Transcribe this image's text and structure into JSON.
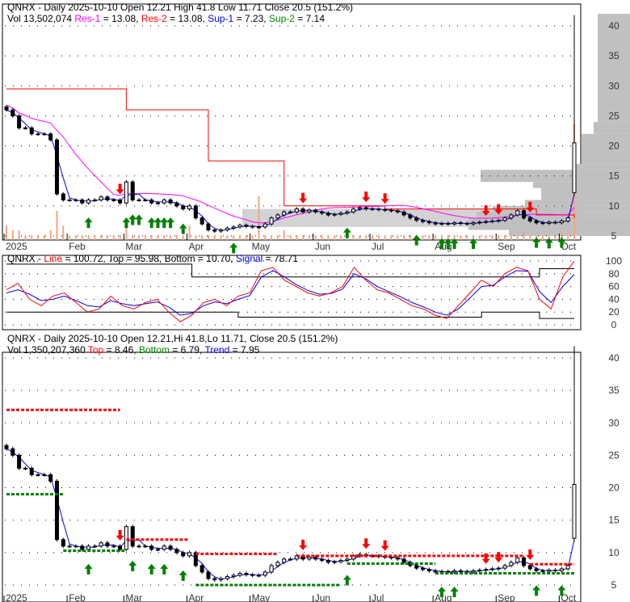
{
  "top_header": {
    "line1": "QNRX - Daily 2025-10-10 Open 12.21  High 41.8  Low 11.71  Close 20.5 (151.2%)",
    "vol": "Vol 13,502,074",
    "res1_label": "Res-1",
    "res1_val": " = 13.08, ",
    "res2_label": "Res-2",
    "res2_val": " = 13.08, ",
    "sup1_label": "Sup-1",
    "sup1_val": " = 7.23, ",
    "sup2_label": "Sup-2",
    "sup2_val": " = 7.14"
  },
  "mid_header": {
    "prefix": "QNRX - ",
    "line_label": "Line",
    "rest": " = 100.72, Top = 95.98, Bottom = 10.70, ",
    "signal_label": "Signal",
    "signal_val": " = 78.71"
  },
  "bot_header": {
    "line1": "QNRX - Daily 2025-10-10 Open 12.21,Hi 41.8,Lo 11.71, Close 20.5 (151.2%)",
    "vol": "Vol 1,350,207,360 ",
    "top_label": "Top",
    "top_val": " = 8.46, ",
    "bottom_label": "Bottom",
    "bottom_val": " = 6.79, ",
    "trend_label": "Trend",
    "trend_val": " = 7.95"
  },
  "colors": {
    "up": "#008000",
    "down": "#ff0000",
    "res1": "#ff00ff",
    "res2": "#ff0000",
    "sup1": "#0000ff",
    "sup2": "#008000",
    "volume": "#f4a582",
    "profile": "#c0c0c0"
  },
  "chart_data": {
    "type": "candlestick",
    "x_ticks": [
      {
        "label": "2025",
        "i": 0
      },
      {
        "label": "Feb",
        "i": 10
      },
      {
        "label": "Mar",
        "i": 19
      },
      {
        "label": "Apr",
        "i": 29
      },
      {
        "label": "May",
        "i": 39
      },
      {
        "label": "Jun",
        "i": 49
      },
      {
        "label": "Jul",
        "i": 58
      },
      {
        "label": "Aug",
        "i": 68
      },
      {
        "label": "Sep",
        "i": 78
      },
      {
        "label": "Oct",
        "i": 88
      }
    ],
    "price_ticks": [
      5,
      10,
      15,
      20,
      25,
      30,
      35,
      40
    ],
    "osc_ticks": [
      0,
      20,
      40,
      60,
      80,
      100
    ],
    "price_range": [
      5,
      42
    ],
    "closes": [
      26,
      25,
      23,
      23,
      22,
      22,
      22,
      21,
      12,
      11,
      11,
      11,
      10.5,
      11,
      11,
      11.5,
      11,
      11,
      10.5,
      14,
      11,
      11,
      11,
      10.5,
      10.5,
      11,
      10.5,
      10,
      9.5,
      10,
      8,
      7,
      6,
      5.8,
      6,
      6.3,
      6.5,
      6.8,
      6.6,
      6.5,
      6.5,
      7,
      8,
      8.5,
      9,
      9,
      9.5,
      9,
      9.3,
      9,
      8.8,
      8.5,
      8.6,
      8.8,
      9,
      9.5,
      9.7,
      9.5,
      9.5,
      9.4,
      9.3,
      9.2,
      9,
      8.5,
      8,
      7.6,
      7.4,
      7.2,
      7,
      7.1,
      7,
      7.2,
      7.1,
      7,
      7.2,
      7.3,
      7.4,
      7.5,
      7.6,
      8,
      8.5,
      9.2,
      8,
      7.5,
      7.2,
      7.1,
      7.3,
      7.2,
      7.5,
      8,
      20.5
    ],
    "last_bar": {
      "open": 12.21,
      "high": 41.8,
      "low": 11.71,
      "close": 20.5
    },
    "res2_steps": [
      [
        0,
        29.5
      ],
      [
        19,
        26
      ],
      [
        32,
        17.5
      ],
      [
        44,
        10
      ],
      [
        60,
        9.5
      ],
      [
        84,
        8.5
      ],
      [
        90,
        8
      ]
    ],
    "volume": [
      3,
      2,
      2,
      1,
      1,
      1,
      1,
      2,
      6,
      3,
      1,
      1,
      1,
      1,
      1,
      1,
      1,
      1,
      1,
      4,
      1,
      1,
      1,
      1,
      1,
      1,
      1,
      1,
      1,
      3,
      1,
      1,
      1,
      1,
      1,
      1,
      1,
      1,
      1,
      1,
      9,
      1,
      1,
      1,
      2,
      1,
      1,
      1,
      1,
      1,
      1,
      1,
      1,
      1,
      1,
      1,
      1,
      1,
      1,
      1,
      1,
      1,
      1,
      1,
      1,
      1,
      1,
      1,
      1,
      1,
      1,
      1,
      1,
      1,
      1,
      1,
      1,
      1,
      1,
      1,
      1,
      1,
      2,
      1,
      1,
      1,
      1,
      1,
      2,
      2,
      24
    ],
    "buy_arrows": [
      13,
      19,
      20,
      21,
      23,
      24,
      25,
      26,
      28,
      36,
      54,
      65,
      69,
      70,
      71,
      74,
      84,
      86,
      88
    ],
    "sell_arrows": [
      18,
      47,
      57,
      60,
      76,
      78,
      83
    ],
    "osc_line": [
      55,
      65,
      40,
      30,
      45,
      50,
      35,
      20,
      25,
      45,
      30,
      25,
      35,
      40,
      20,
      5,
      15,
      35,
      40,
      30,
      45,
      50,
      85,
      90,
      70,
      60,
      50,
      45,
      50,
      60,
      90,
      70,
      55,
      50,
      40,
      30,
      25,
      15,
      10,
      30,
      50,
      70,
      60,
      80,
      90,
      85,
      40,
      25,
      75,
      100
    ],
    "osc_signal": [
      50,
      55,
      48,
      38,
      40,
      45,
      38,
      30,
      28,
      38,
      33,
      30,
      33,
      36,
      28,
      15,
      18,
      30,
      36,
      33,
      40,
      46,
      75,
      85,
      75,
      63,
      54,
      48,
      49,
      56,
      80,
      72,
      60,
      52,
      44,
      35,
      28,
      20,
      15,
      25,
      42,
      60,
      62,
      75,
      85,
      84,
      52,
      35,
      60,
      79
    ],
    "osc_top": [
      [
        0,
        95
      ],
      [
        16,
        75
      ],
      [
        46,
        88
      ]
    ],
    "osc_bottom": [
      [
        0,
        20
      ],
      [
        20,
        12
      ],
      [
        41,
        20
      ],
      [
        46,
        10
      ]
    ],
    "levels": [
      {
        "kind": "top",
        "from": 0,
        "to": 18,
        "value": 32
      },
      {
        "kind": "bottom",
        "from": 0,
        "to": 9,
        "value": 19
      },
      {
        "kind": "bottom",
        "from": 9,
        "to": 19,
        "value": 10.3
      },
      {
        "kind": "top",
        "from": 19,
        "to": 29,
        "value": 12
      },
      {
        "kind": "top",
        "from": 30,
        "to": 43,
        "value": 9.8
      },
      {
        "kind": "bottom",
        "from": 30,
        "to": 53,
        "value": 5
      },
      {
        "kind": "top",
        "from": 46,
        "to": 82,
        "value": 9.5
      },
      {
        "kind": "bottom",
        "from": 54,
        "to": 68,
        "value": 8.3
      },
      {
        "kind": "bottom",
        "from": 68,
        "to": 90,
        "value": 6.8
      },
      {
        "kind": "top",
        "from": 83,
        "to": 90,
        "value": 8.2
      }
    ]
  }
}
